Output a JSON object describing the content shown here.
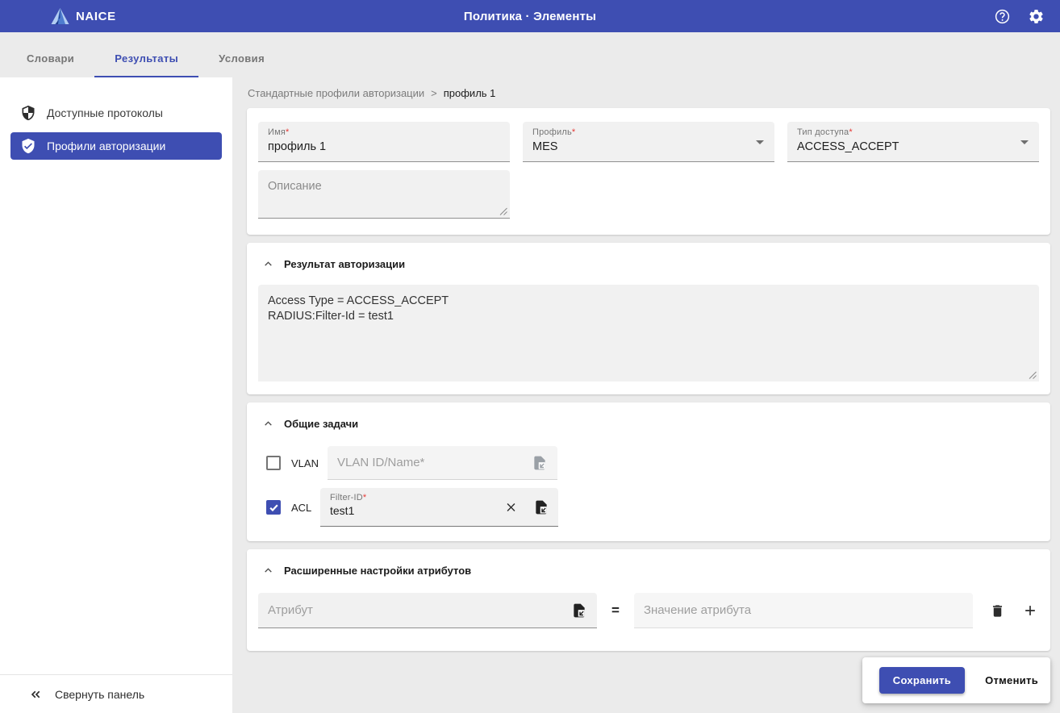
{
  "colors": {
    "primary": "#3e4eb2",
    "page_bg": "#ebebeb",
    "required": "#e53935"
  },
  "misc": {
    "required_mark": "*"
  },
  "appbar": {
    "brand": "NAICE",
    "title": "Политика · Элементы",
    "icons": [
      "menu-icon",
      "help-icon",
      "gear-icon"
    ]
  },
  "tabs": [
    {
      "label": "Словари",
      "active": false
    },
    {
      "label": "Результаты",
      "active": true
    },
    {
      "label": "Условия",
      "active": false
    }
  ],
  "sidebar": {
    "items": [
      {
        "label": "Доступные протоколы",
        "icon": "shield-half-icon",
        "active": false
      },
      {
        "label": "Профили авторизации",
        "icon": "shield-check-icon",
        "active": true
      }
    ],
    "collapse_label": "Свернуть панель",
    "collapse_icon": "double-chevron-left-icon"
  },
  "breadcrumb": {
    "parent": "Стандартные профили авторизации",
    "separator": ">",
    "current": "профиль 1"
  },
  "form": {
    "name": {
      "label": "Имя",
      "value": "профиль 1"
    },
    "profile": {
      "label": "Профиль",
      "value": "MES"
    },
    "access_type": {
      "label": "Тип доступа",
      "value": "ACCESS_ACCEPT"
    },
    "description": {
      "placeholder": "Описание"
    }
  },
  "auth_result": {
    "title": "Результат авторизации",
    "value": "Access Type = ACCESS_ACCEPT\nRADIUS:Filter-Id = test1"
  },
  "common_tasks": {
    "title": "Общие задачи",
    "vlan": {
      "checkbox_label": "VLAN",
      "checked": false,
      "placeholder": "VLAN ID/Name*"
    },
    "acl": {
      "checkbox_label": "ACL",
      "checked": true,
      "field_label": "Filter-ID",
      "value": "test1"
    }
  },
  "advanced": {
    "title": "Расширенные настройки атрибутов",
    "attribute_placeholder": "Атрибут",
    "equals": "=",
    "value_placeholder": "Значение атрибута"
  },
  "actions": {
    "save": "Сохранить",
    "cancel": "Отменить"
  }
}
